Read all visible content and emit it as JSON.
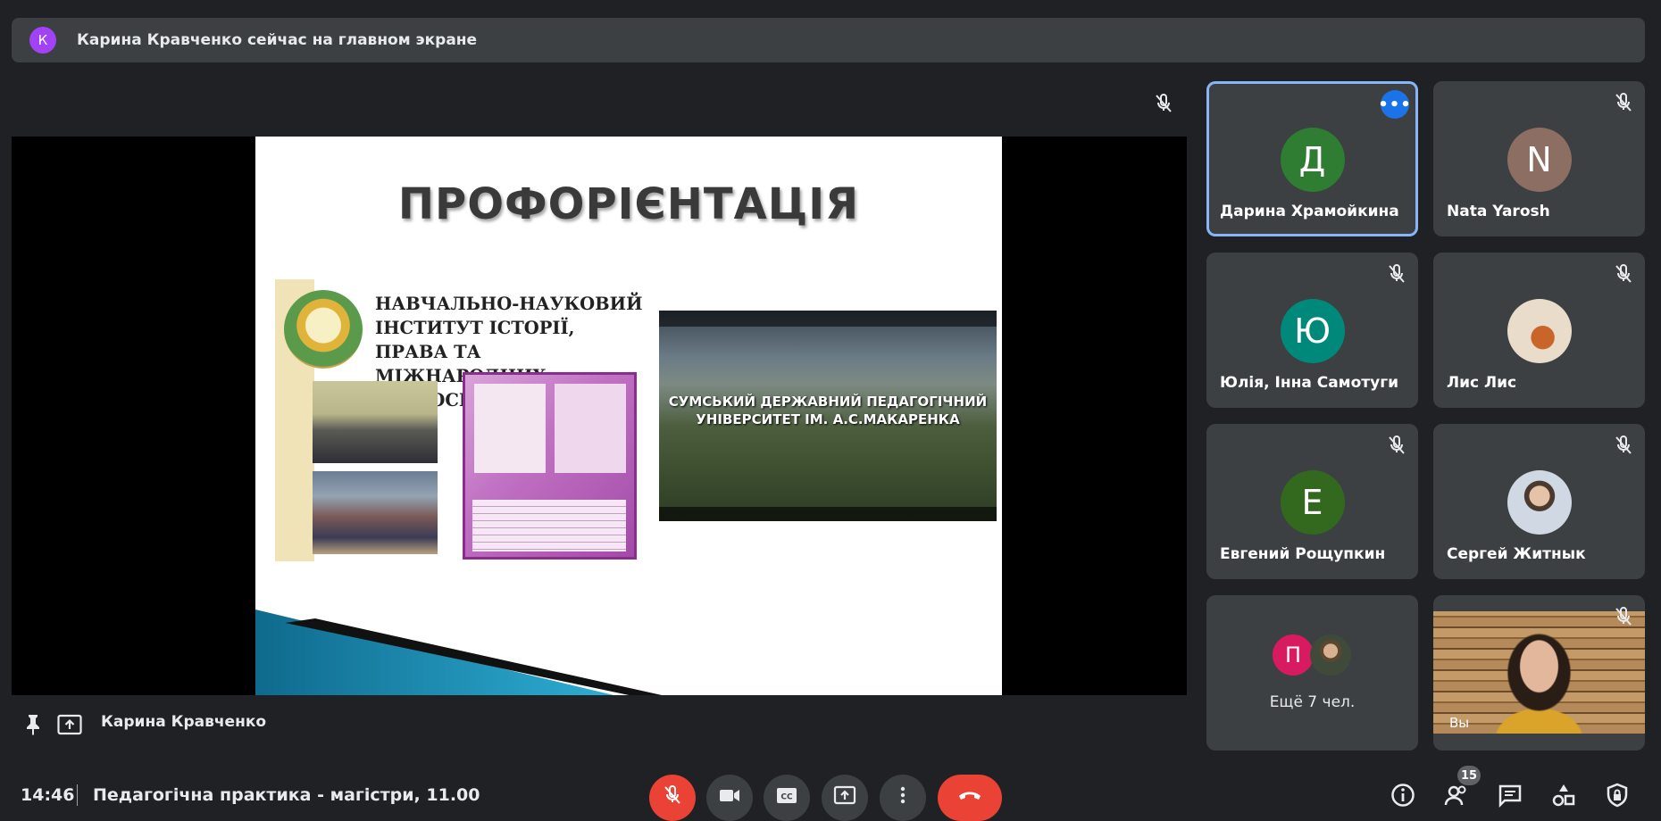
{
  "banner": {
    "avatar_letter": "К",
    "text": "Карина Кравченко сейчас на главном экране"
  },
  "slide": {
    "title": "ПРОФОРІЄНТАЦІЯ",
    "brochure_heading": "НАВЧАЛЬНО-НАУКОВИЙ ІНСТИТУТ ІСТОРІЇ, ПРАВА ТА МІЖНАРОДНИХ ВІДНОСИН",
    "video_text": "СУМСЬКИЙ ДЕРЖАВНИЙ ПЕДАГОГІЧНИЙ УНІВЕРСИТЕТ ІМ. А.С.МАКАРЕНКА"
  },
  "presenter": {
    "name": "Карина Кравченко"
  },
  "participants": [
    {
      "name": "Дарина Храмойкина",
      "initial": "Д",
      "color": "#2e7d32",
      "active": true
    },
    {
      "name": "Nata Yarosh",
      "initial": "N",
      "color": "#8d6e63",
      "active": false
    },
    {
      "name": "Юлія, Інна Самотуги",
      "initial": "Ю",
      "color": "#00897b",
      "active": false
    },
    {
      "name": "Лис Лис",
      "initial": "",
      "color": "#d9c3a8",
      "active": false
    },
    {
      "name": "Евгений Рощупкин",
      "initial": "Е",
      "color": "#33691e",
      "active": false
    },
    {
      "name": "Сергей Житнык",
      "initial": "",
      "color": "#c9b8a6",
      "active": false
    }
  ],
  "more_tile": {
    "initial": "П",
    "label": "Ещё 7 чел."
  },
  "self_tile": {
    "label": "Вы"
  },
  "bottom": {
    "time": "14:46",
    "meeting_title": "Педагогічна практика - магістри, 11.00",
    "participants_count": "15"
  }
}
